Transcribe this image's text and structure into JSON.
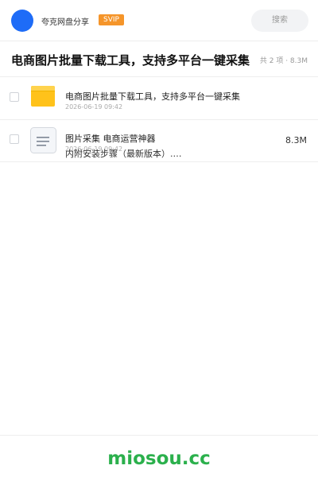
{
  "header": {
    "app_name": "夸克网盘分享",
    "vip_badge": "SVIP",
    "search_label": "搜索"
  },
  "share": {
    "title": "电商图片批量下载工具，支持多平台一键采集",
    "meta": "共 2 项 · 8.3M"
  },
  "files": [
    {
      "type": "folder",
      "name": "电商图片批量下载工具，支持多平台一键采集",
      "date": "2026-06-19 09:42",
      "size": ""
    },
    {
      "type": "document",
      "name": "图片采集 电商运营神器",
      "date": "2026-06-19 09:42",
      "description": "内附安装步骤（最新版本）.…",
      "size": "8.3M"
    }
  ],
  "footer": {
    "watermark": "miosou.cc"
  },
  "colors": {
    "avatar": "#1e6cf7",
    "vip_badge": "#f5952a",
    "folder": "#ffc21a",
    "watermark": "#2bb04c"
  }
}
